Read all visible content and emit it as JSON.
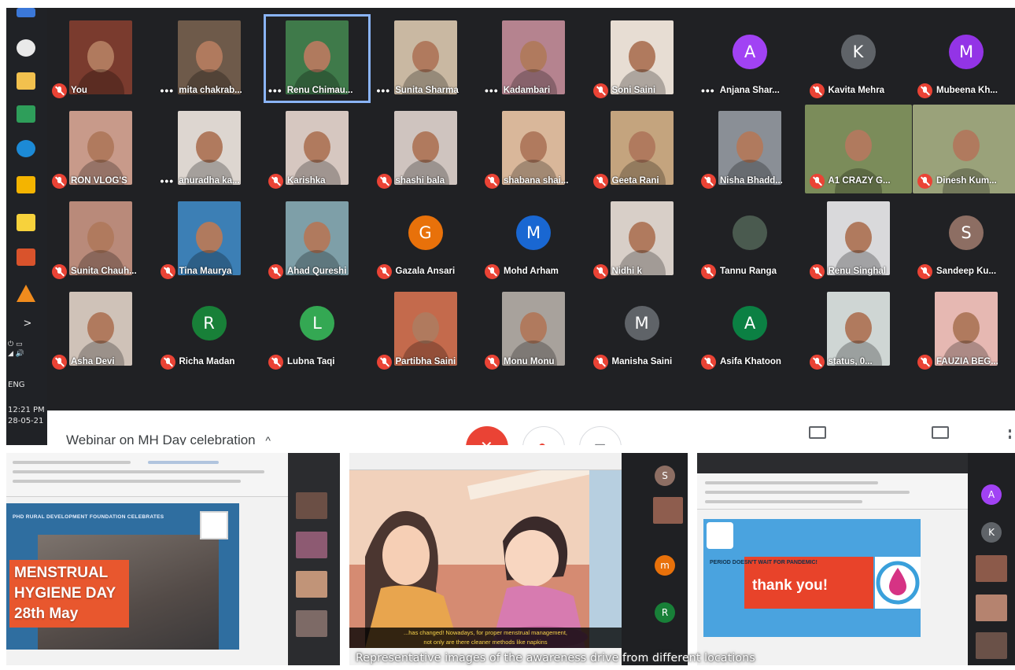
{
  "meet": {
    "meeting_title": "Webinar on MH Day celebration",
    "title_chevron": "^",
    "participants": [
      {
        "name": "You",
        "mic": "off",
        "video": true,
        "photo_color": "#7a3b2e"
      },
      {
        "name": "mita chakrab...",
        "mic": "dots",
        "video": true,
        "photo_color": "#6e5a4a"
      },
      {
        "name": "Renu Chimau...",
        "mic": "dots",
        "video": true,
        "photo_color": "#3f7a4a",
        "speaking": true
      },
      {
        "name": "Sunita Sharma",
        "mic": "dots",
        "video": true,
        "photo_color": "#c9b8a2"
      },
      {
        "name": "Kadambari",
        "mic": "dots",
        "video": true,
        "photo_color": "#b5838f"
      },
      {
        "name": "Soni Saini",
        "mic": "off",
        "video": true,
        "photo_color": "#e7ddd3"
      },
      {
        "name": "Anjana Shar...",
        "mic": "dots",
        "video": false,
        "initial": "A",
        "avatar_color": "#a142f4"
      },
      {
        "name": "Kavita Mehra",
        "mic": "off",
        "video": false,
        "initial": "K",
        "avatar_color": "#5f6368"
      },
      {
        "name": "Mubeena Kh...",
        "mic": "off",
        "video": false,
        "initial": "M",
        "avatar_color": "#9334e6"
      },
      {
        "name": "RON VLOG'S",
        "mic": "off",
        "video": true,
        "photo_color": "#c89a8a"
      },
      {
        "name": "anuradha ka...",
        "mic": "dots",
        "video": true,
        "photo_color": "#ddd6d0"
      },
      {
        "name": "Karishka",
        "mic": "off",
        "video": true,
        "photo_color": "#d6c7c0"
      },
      {
        "name": "shashi bala",
        "mic": "off",
        "video": true,
        "photo_color": "#cfc4bf"
      },
      {
        "name": "shabana shai...",
        "mic": "off",
        "video": true,
        "photo_color": "#d9b79a"
      },
      {
        "name": "Geeta Rani",
        "mic": "off",
        "video": true,
        "photo_color": "#c4a47e"
      },
      {
        "name": "Nisha Bhadd...",
        "mic": "off",
        "video": true,
        "photo_color": "#8a8f96"
      },
      {
        "name": "A1 CRAZY G...",
        "mic": "off",
        "video": true,
        "photo_color": "#7b8c5a",
        "wide": true
      },
      {
        "name": "Dinesh Kum...",
        "mic": "off",
        "video": true,
        "photo_color": "#9aa27a",
        "wide": true
      },
      {
        "name": "Sunita Chauh...",
        "mic": "off",
        "video": true,
        "photo_color": "#b98a7a"
      },
      {
        "name": "Tina Maurya",
        "mic": "off",
        "video": true,
        "photo_color": "#3c7fb5"
      },
      {
        "name": "Ahad Qureshi",
        "mic": "off",
        "video": true,
        "photo_color": "#7e9fa8"
      },
      {
        "name": "Gazala Ansari",
        "mic": "off",
        "video": false,
        "initial": "G",
        "avatar_color": "#e8710a"
      },
      {
        "name": "Mohd Arham",
        "mic": "off",
        "video": false,
        "initial": "M",
        "avatar_color": "#1967d2"
      },
      {
        "name": "Nidhi k",
        "mic": "off",
        "video": true,
        "photo_color": "#d8cfc8"
      },
      {
        "name": "Tannu Ranga",
        "mic": "off",
        "video": false,
        "photo_color": "#4a5a4f",
        "round": true
      },
      {
        "name": "Renu Singhal",
        "mic": "off",
        "video": true,
        "photo_color": "#d9d9db"
      },
      {
        "name": "Sandeep Ku...",
        "mic": "off",
        "video": false,
        "initial": "S",
        "avatar_color": "#8d6e63"
      },
      {
        "name": "Asha Devi",
        "mic": "off",
        "video": true,
        "photo_color": "#cfc2b8"
      },
      {
        "name": "Richa Madan",
        "mic": "off",
        "video": false,
        "initial": "R",
        "avatar_color": "#188038"
      },
      {
        "name": "Lubna Taqi",
        "mic": "off",
        "video": false,
        "initial": "L",
        "avatar_color": "#34a853"
      },
      {
        "name": "Partibha Saini",
        "mic": "off",
        "video": true,
        "photo_color": "#c46a4c"
      },
      {
        "name": "Monu Monu",
        "mic": "off",
        "video": true,
        "photo_color": "#a8a29c"
      },
      {
        "name": "Manisha Saini",
        "mic": "off",
        "video": false,
        "initial": "M",
        "avatar_color": "#5f6368"
      },
      {
        "name": "Asifa Khatoon",
        "mic": "off",
        "video": false,
        "initial": "A",
        "avatar_color": "#0b8043"
      },
      {
        "name": "status, 0...",
        "mic": "off",
        "video": true,
        "photo_color": "#cfd6d4"
      },
      {
        "name": "FAUZIA BEG...",
        "mic": "off",
        "video": true,
        "photo_color": "#e6b8b2"
      }
    ]
  },
  "taskbar": {
    "chevron": ">",
    "tray": "ENG",
    "time": "12:21 PM",
    "date": "28-05-21"
  },
  "slide1": {
    "org": "PHD RURAL DEVELOPMENT FOUNDATION CELEBRATES",
    "line1": "MENSTRUAL",
    "line2": "HYGIENE DAY",
    "line3": "28th May"
  },
  "slide2": {
    "subtitle_line1": "...has changed! Nowadays, for proper menstrual management,",
    "subtitle_line2": "not only are there cleaner methods like napkins"
  },
  "slide3": {
    "headline": "PERIOD DOESN'T WAIT FOR PANDEMIC!",
    "thanks": "thank you!"
  },
  "caption": "Representative images of the awareness drive from different locations"
}
